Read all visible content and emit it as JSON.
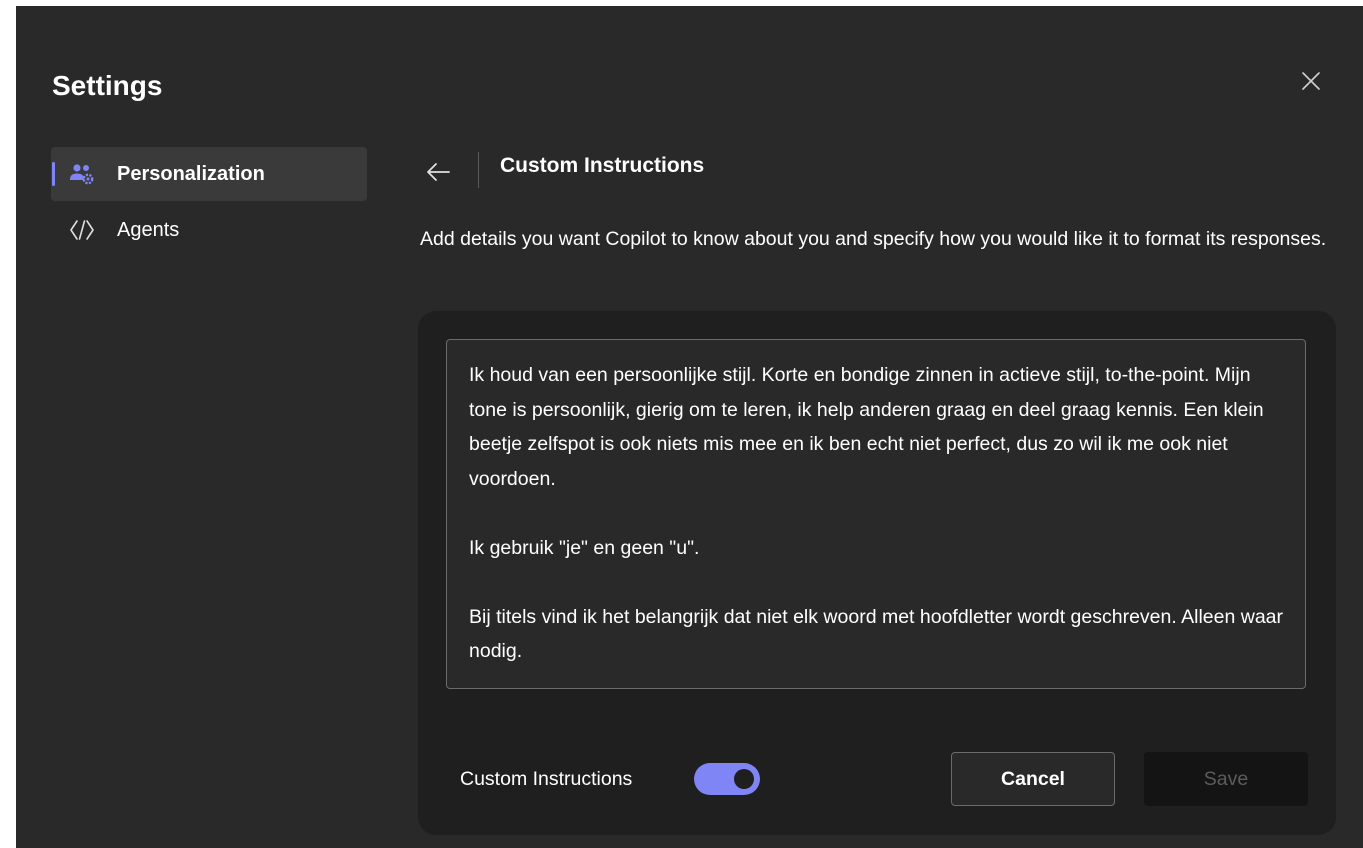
{
  "dialog": {
    "title": "Settings",
    "close_icon": "close-icon"
  },
  "sidebar": {
    "items": [
      {
        "label": "Personalization",
        "icon": "people-settings-icon",
        "selected": true
      },
      {
        "label": "Agents",
        "icon": "agents-icon",
        "selected": false
      }
    ]
  },
  "main": {
    "back_icon": "arrow-left-icon",
    "section_title": "Custom Instructions",
    "description": "Add details you want Copilot to know about you and specify how you would like it to format its responses.",
    "instructions_text": "Ik houd van een persoonlijke stijl. Korte en bondige zinnen in actieve stijl, to-the-point. Mijn tone is persoonlijk, gierig om te leren, ik help anderen graag en deel graag kennis. Een klein beetje zelfspot is ook niets mis mee en ik ben echt niet perfect, dus zo wil ik me ook niet voordoen.\n\nIk gebruik \"je\" en geen \"u\".\n\nBij titels vind ik het belangrijk dat niet elk woord met hoofdletter wordt geschreven. Alleen waar nodig.",
    "toggle_label": "Custom Instructions",
    "toggle_on": true,
    "cancel_label": "Cancel",
    "save_label": "Save"
  },
  "colors": {
    "accent": "#7f85f5",
    "dialog_bg": "#292929",
    "card_bg": "#1f1f1f"
  }
}
